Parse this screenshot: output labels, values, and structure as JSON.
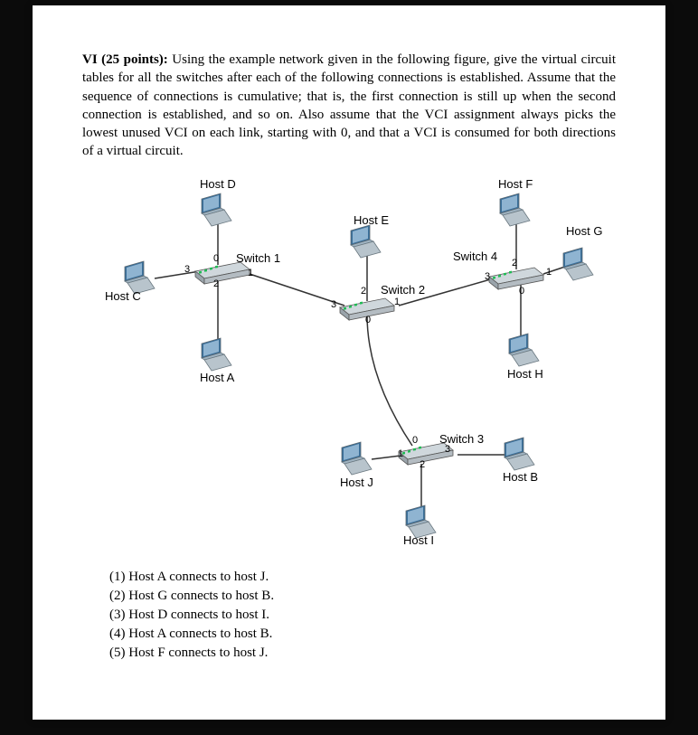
{
  "question": {
    "heading": "VI (25 points):",
    "body": " Using the example network given in the following figure, give the virtual circuit tables for all the switches after each of the following connections is established. Assume that the sequence of connections is cumulative; that is, the first connection is still up when the second connection is established, and so on. Also assume that the VCI assignment always picks the lowest unused VCI on each link, starting with 0, and that a VCI is consumed for both directions of a virtual circuit."
  },
  "diagram": {
    "hosts": {
      "A": "Host A",
      "B": "Host B",
      "C": "Host C",
      "D": "Host D",
      "E": "Host E",
      "F": "Host F",
      "G": "Host G",
      "H": "Host H",
      "I": "Host I",
      "J": "Host J"
    },
    "switches": {
      "s1": "Switch 1",
      "s2": "Switch 2",
      "s3": "Switch 3",
      "s4": "Switch 4"
    },
    "ports": {
      "s1_p0": "0",
      "s1_p1": "1",
      "s1_p2": "2",
      "s1_p3": "3",
      "s2_p0": "0",
      "s2_p1": "1",
      "s2_p2": "2",
      "s2_p3": "3",
      "s3_p0": "0",
      "s3_p1": "1",
      "s3_p2": "2",
      "s3_p3": "3",
      "s4_p0": "0",
      "s4_p1": "1",
      "s4_p2": "2",
      "s4_p3": "3"
    }
  },
  "connections": [
    "(1) Host A connects to host J.",
    "(2) Host G connects to host B.",
    "(3) Host D connects to host I.",
    "(4) Host A connects to host B.",
    "(5) Host F connects to host J."
  ]
}
